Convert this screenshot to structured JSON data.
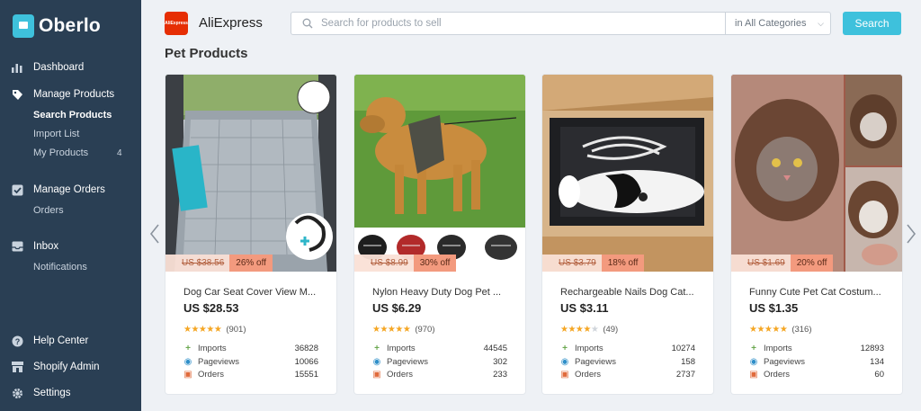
{
  "app": {
    "name": "Oberlo"
  },
  "sidebar": {
    "dashboard": "Dashboard",
    "manage_products": "Manage Products",
    "search_products": "Search Products",
    "import_list": "Import List",
    "my_products": "My Products",
    "my_products_count": "4",
    "manage_orders": "Manage Orders",
    "orders": "Orders",
    "inbox": "Inbox",
    "notifications": "Notifications",
    "help_center": "Help Center",
    "shopify_admin": "Shopify Admin",
    "settings": "Settings"
  },
  "topbar": {
    "supplier": "AliExpress",
    "supplier_logo_text": "AliExpress",
    "search_placeholder": "Search for products to sell",
    "category": "in All Categories",
    "search_button": "Search"
  },
  "section_title": "Pet Products",
  "stat_labels": {
    "imports": "Imports",
    "pageviews": "Pageviews",
    "orders": "Orders"
  },
  "colors": {
    "sidebar": "#2a3f54",
    "accent": "#3ec1dc",
    "star": "#f5a623",
    "discount": "#f39a7e"
  },
  "products": [
    {
      "title": "Dog Car Seat Cover View M...",
      "price": "US $28.53",
      "old_price": "US $38.56",
      "discount": "26% off",
      "rating": 5,
      "reviews": "(901)",
      "imports": "36828",
      "pageviews": "10066",
      "orders": "15551"
    },
    {
      "title": "Nylon Heavy Duty Dog Pet ...",
      "price": "US $6.29",
      "old_price": "US $8.99",
      "discount": "30% off",
      "rating": 5,
      "reviews": "(970)",
      "imports": "44545",
      "pageviews": "302",
      "orders": "233"
    },
    {
      "title": "Rechargeable Nails Dog Cat...",
      "price": "US $3.11",
      "old_price": "US $3.79",
      "discount": "18% off",
      "rating": 4,
      "reviews": "(49)",
      "imports": "10274",
      "pageviews": "158",
      "orders": "2737"
    },
    {
      "title": "Funny Cute Pet Cat Costum...",
      "price": "US $1.35",
      "old_price": "US $1.69",
      "discount": "20% off",
      "rating": 5,
      "reviews": "(316)",
      "imports": "12893",
      "pageviews": "134",
      "orders": "60"
    }
  ]
}
